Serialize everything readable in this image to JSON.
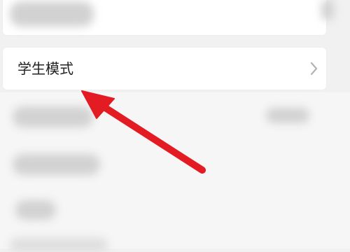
{
  "setting": {
    "label": "学生模式"
  },
  "colors": {
    "page_background": "#f1f1f1",
    "card_background": "#ffffff",
    "primary_text": "#222222",
    "chevron": "#b3b3b3",
    "arrow": "#e31b23",
    "blur_placeholder": "#d2d2d2"
  },
  "icons": {
    "chevron": "chevron-right-icon",
    "annotation": "arrow-pointer-icon"
  }
}
